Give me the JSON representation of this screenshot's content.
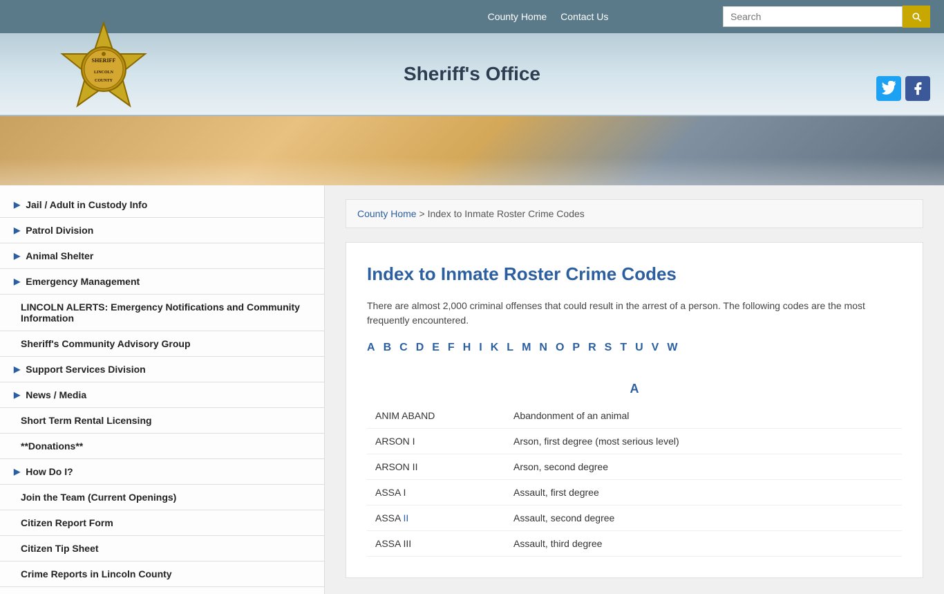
{
  "topbar": {
    "nav_items": [
      {
        "label": "County Home",
        "id": "county-home"
      },
      {
        "label": "Contact Us",
        "id": "contact-us"
      }
    ],
    "search_placeholder": "Search"
  },
  "header": {
    "title": "Sheriff's Office",
    "social": {
      "twitter_label": "Twitter",
      "facebook_label": "Facebook"
    }
  },
  "sidebar": {
    "items": [
      {
        "id": "jail-info",
        "label": "Jail / Adult in Custody Info",
        "has_arrow": true,
        "sub": false
      },
      {
        "id": "patrol-division",
        "label": "Patrol Division",
        "has_arrow": true,
        "sub": false
      },
      {
        "id": "animal-shelter",
        "label": "Animal Shelter",
        "has_arrow": true,
        "sub": false
      },
      {
        "id": "emergency-mgmt",
        "label": "Emergency Management",
        "has_arrow": true,
        "sub": false
      },
      {
        "id": "lincoln-alerts",
        "label": "LINCOLN ALERTS: Emergency Notifications and Community Information",
        "has_arrow": false,
        "sub": true
      },
      {
        "id": "advisory-group",
        "label": "Sheriff's Community Advisory Group",
        "has_arrow": false,
        "sub": true
      },
      {
        "id": "support-services",
        "label": "Support Services Division",
        "has_arrow": true,
        "sub": false
      },
      {
        "id": "news-media",
        "label": "News / Media",
        "has_arrow": true,
        "sub": false
      },
      {
        "id": "short-term-rental",
        "label": "Short Term Rental Licensing",
        "has_arrow": false,
        "sub": true
      },
      {
        "id": "donations",
        "label": "**Donations**",
        "has_arrow": false,
        "sub": true
      },
      {
        "id": "how-do-i",
        "label": "How Do I?",
        "has_arrow": true,
        "sub": false
      },
      {
        "id": "join-team",
        "label": "Join the Team (Current Openings)",
        "has_arrow": false,
        "sub": true
      },
      {
        "id": "citizen-report",
        "label": "Citizen Report Form",
        "has_arrow": false,
        "sub": true
      },
      {
        "id": "citizen-tip",
        "label": "Citizen Tip Sheet",
        "has_arrow": false,
        "sub": true
      },
      {
        "id": "crime-reports",
        "label": "Crime Reports in Lincoln County",
        "has_arrow": false,
        "sub": true
      }
    ]
  },
  "breadcrumb": {
    "home_label": "County Home",
    "separator": " > ",
    "current": "Index to Inmate Roster Crime Codes"
  },
  "page": {
    "heading": "Index to Inmate Roster Crime Codes",
    "intro": "There are almost 2,000 criminal offenses that could result in the arrest of a person. The following codes are the most frequently encountered.",
    "alphabet": [
      "A",
      "B",
      "C",
      "D",
      "E",
      "F",
      "H",
      "I",
      "K",
      "L",
      "M",
      "N",
      "O",
      "P",
      "R",
      "S",
      "T",
      "U",
      "V",
      "W"
    ],
    "section_a_heading": "A",
    "crimes": [
      {
        "code": "ANIM ABAND",
        "code_roman": "",
        "description": "Abandonment of an animal"
      },
      {
        "code": "ARSON I",
        "code_roman": "",
        "description": "Arson, first degree (most serious level)"
      },
      {
        "code": "ARSON II",
        "code_roman": "",
        "description": "Arson, second degree"
      },
      {
        "code": "ASSA I",
        "code_roman": "",
        "description": "Assault, first degree"
      },
      {
        "code": "ASSA II",
        "code_roman": "II",
        "description": "Assault, second degree"
      },
      {
        "code": "ASSA III",
        "code_roman": "",
        "description": "Assault, third degree"
      }
    ]
  }
}
